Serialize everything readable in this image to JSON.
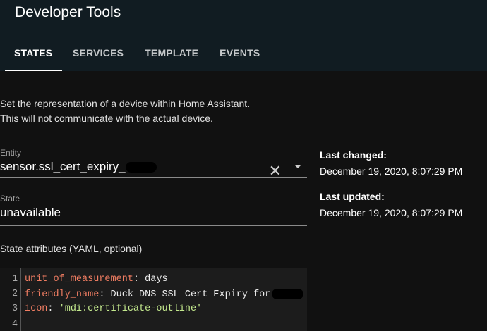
{
  "header": {
    "title": "Developer Tools",
    "tabs": [
      {
        "label": "STATES"
      },
      {
        "label": "SERVICES"
      },
      {
        "label": "TEMPLATE"
      },
      {
        "label": "EVENTS"
      }
    ]
  },
  "description": [
    "Set the representation of a device within Home Assistant.",
    "This will not communicate with the actual device."
  ],
  "entity": {
    "label": "Entity",
    "value": "sensor.ssl_cert_expiry_"
  },
  "state": {
    "label": "State",
    "value": "unavailable"
  },
  "last_changed": {
    "label": "Last changed:",
    "value": "December 19, 2020, 8:07:29 PM"
  },
  "last_updated": {
    "label": "Last updated:",
    "value": "December 19, 2020, 8:07:29 PM"
  },
  "attributes": {
    "label": "State attributes (YAML, optional)",
    "lines": [
      {
        "n": "1",
        "key": "unit_of_measurement",
        "val": " days"
      },
      {
        "n": "2",
        "key": "friendly_name",
        "val": " Duck DNS SSL Cert Expiry for"
      },
      {
        "n": "3",
        "key": "icon",
        "val": " 'mdi:certificate-outline'"
      },
      {
        "n": "4",
        "key": "",
        "val": ""
      }
    ]
  }
}
